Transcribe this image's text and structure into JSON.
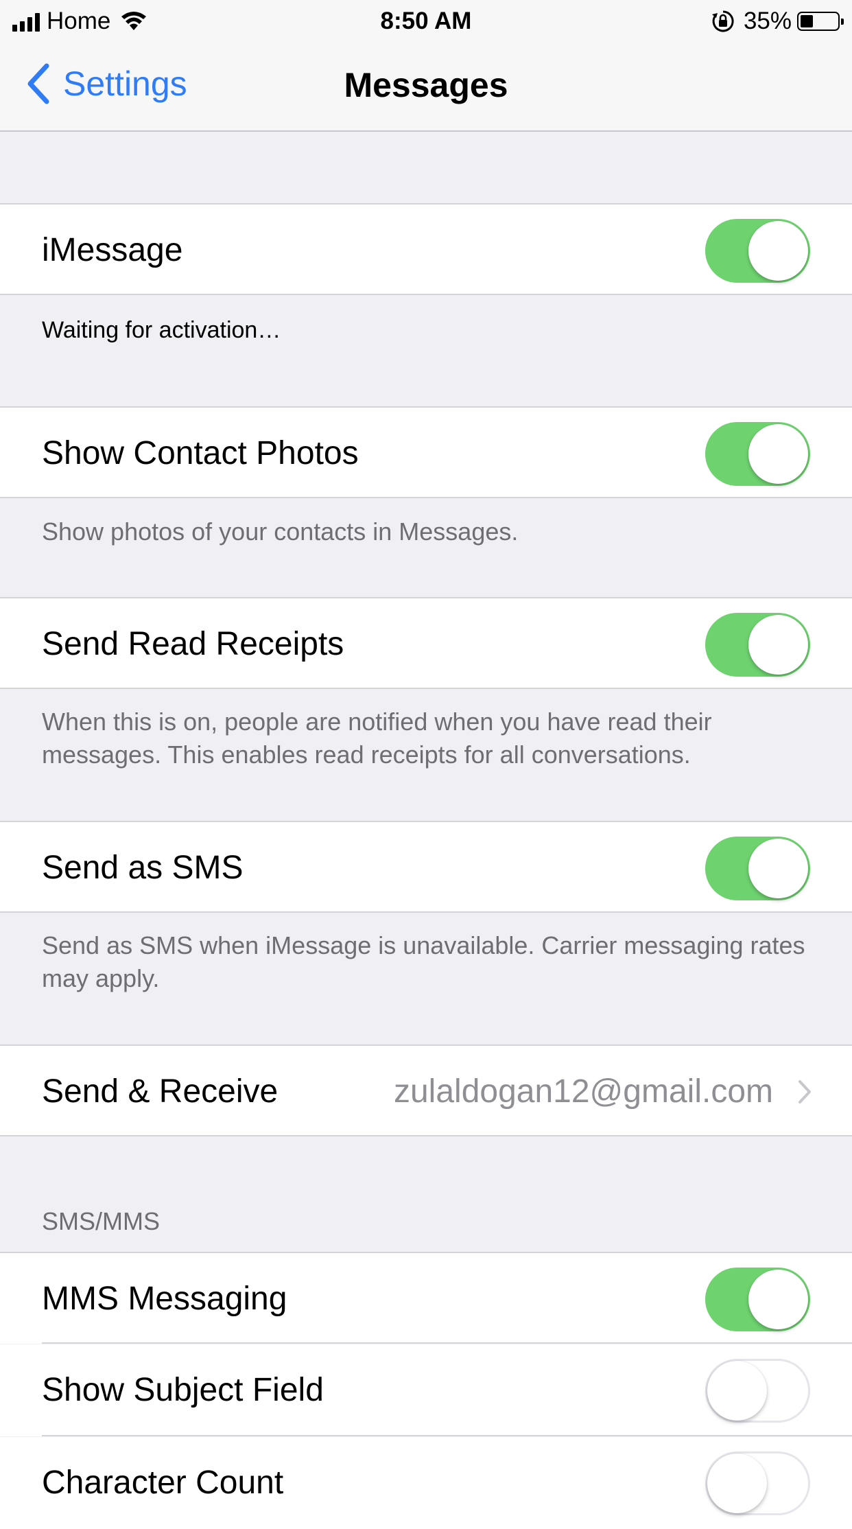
{
  "status_bar": {
    "carrier": "Home",
    "time": "8:50 AM",
    "battery_percent": "35%",
    "battery_level": 0.35,
    "icons": [
      "signal-icon",
      "wifi-icon",
      "orientation-lock-icon",
      "battery-icon"
    ]
  },
  "nav": {
    "back_label": "Settings",
    "title": "Messages"
  },
  "rows": {
    "imessage": {
      "label": "iMessage",
      "on": true
    },
    "imessage_footer": "Waiting for activation…",
    "contact_photos": {
      "label": "Show Contact Photos",
      "on": true
    },
    "contact_photos_footer": "Show photos of your contacts in Messages.",
    "read_receipts": {
      "label": "Send Read Receipts",
      "on": true
    },
    "read_receipts_footer": "When this is on, people are notified when you have read their messages. This enables read receipts for all conversations.",
    "send_sms": {
      "label": "Send as SMS",
      "on": true
    },
    "send_sms_footer": "Send as SMS when iMessage is unavailable. Carrier messaging rates may apply.",
    "send_receive": {
      "label": "Send & Receive",
      "value": "zulaldogan12@gmail.com"
    },
    "sms_mms_header": "SMS/MMS",
    "mms_messaging": {
      "label": "MMS Messaging",
      "on": true
    },
    "subject_field": {
      "label": "Show Subject Field",
      "on": false
    },
    "character_count": {
      "label": "Character Count",
      "on": false
    }
  },
  "colors": {
    "accent": "#2f7cf6",
    "toggle_on": "#6ed36f",
    "group_background": "#efeff4",
    "secondary_text": "#6d6d72"
  }
}
